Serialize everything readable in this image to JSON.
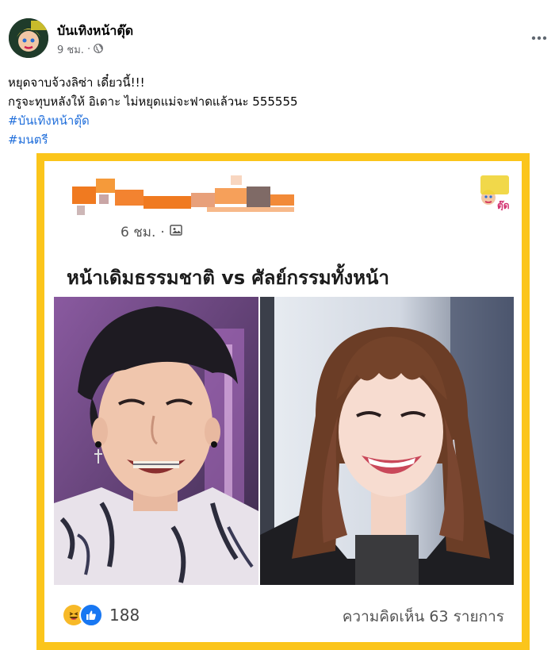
{
  "post": {
    "author": "บันเทิงหน้าตุ๊ด",
    "time": "9 ชม.",
    "separator": "·",
    "caption_lines": [
      "หยุดจาบจ้วงลิซ่า เดี๋ยวนี้!!!",
      "กรูจะทุบหลังให้ อิเดาะ ไม่หยุดแม่จะฟาดแล้วนะ 555555"
    ],
    "hashtags": [
      "#บันเทิงหน้าตุ๊ด",
      "#มนตรี"
    ]
  },
  "shared": {
    "time": "6 ชม.",
    "separator": "·",
    "title": "หน้าเดิมธรรมชาติ vs ศัลย์กรรมทั้งหน้า",
    "reaction_count": "188",
    "comments": "ความคิดเห็น 63 รายการ",
    "logo_text": "ตุ๊ด"
  },
  "colors": {
    "frame": "#fbc51b",
    "hashtag": "#216fdb",
    "like_blue": "#1877f2",
    "haha_yellow": "#f7b928"
  },
  "icons": {
    "globe": "globe-icon",
    "more": "more-options-icon",
    "photo": "photo-icon",
    "haha": "haha-reaction-icon",
    "like": "like-reaction-icon"
  }
}
